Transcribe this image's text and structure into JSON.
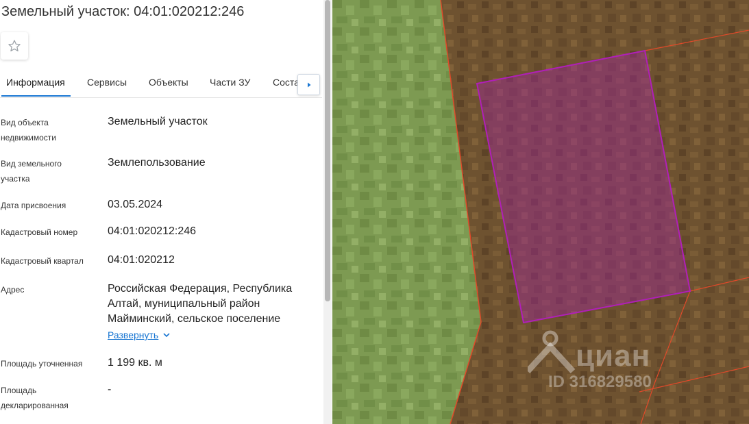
{
  "header": {
    "title": "Земельный участок: 04:01:020212:246"
  },
  "tabs": [
    {
      "label": "Информация"
    },
    {
      "label": "Сервисы"
    },
    {
      "label": "Объекты"
    },
    {
      "label": "Части ЗУ"
    },
    {
      "label": "Соста"
    }
  ],
  "fields": [
    {
      "label": "Вид объекта недвижимости",
      "value": "Земельный участок"
    },
    {
      "label": "Вид земельного участка",
      "value": "Землепользование"
    },
    {
      "label": "Дата присвоения",
      "value": "03.05.2024"
    },
    {
      "label": "Кадастровый номер",
      "value": "04:01:020212:246"
    },
    {
      "label": "Кадастровый квартал",
      "value": "04:01:020212"
    },
    {
      "label": "Адрес",
      "value": "Российская Федерация, Республика Алтай, муниципальный район Майминский, сельское поселение"
    },
    {
      "label": "Площадь уточненная",
      "value": "1 199 кв. м"
    },
    {
      "label": "Площадь декларированная",
      "value": "-"
    }
  ],
  "address_expand": {
    "label": "Развернуть"
  },
  "watermark": {
    "brand": "циан",
    "id": "ID 316829580"
  },
  "icons": {
    "star": "star-outline-icon",
    "next": "caret-right-icon",
    "expand": "chevron-down-icon",
    "pin": "location-pin-icon"
  },
  "colors": {
    "accent": "#1976d2",
    "parcel": "#a020a0",
    "boundary": "#e04a2a"
  }
}
